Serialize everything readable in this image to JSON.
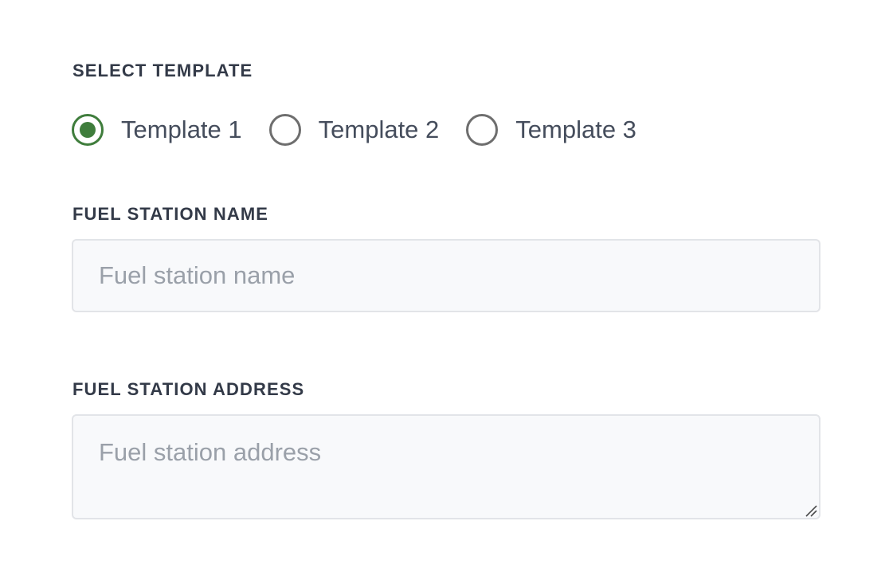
{
  "template_section": {
    "label": "SELECT TEMPLATE",
    "options": [
      {
        "label": "Template 1",
        "checked": true
      },
      {
        "label": "Template 2",
        "checked": false
      },
      {
        "label": "Template 3",
        "checked": false
      }
    ],
    "selected_color": "#3f7d3c",
    "unselected_color": "#6e6e6e"
  },
  "name_section": {
    "label": "FUEL STATION NAME",
    "value": "",
    "placeholder": "Fuel station name"
  },
  "address_section": {
    "label": "FUEL STATION ADDRESS",
    "value": "",
    "placeholder": "Fuel station address"
  },
  "icons": {
    "radio_selected": "radio-selected-icon",
    "radio_unselected": "radio-unselected-icon",
    "resize": "resize-grip-icon"
  }
}
